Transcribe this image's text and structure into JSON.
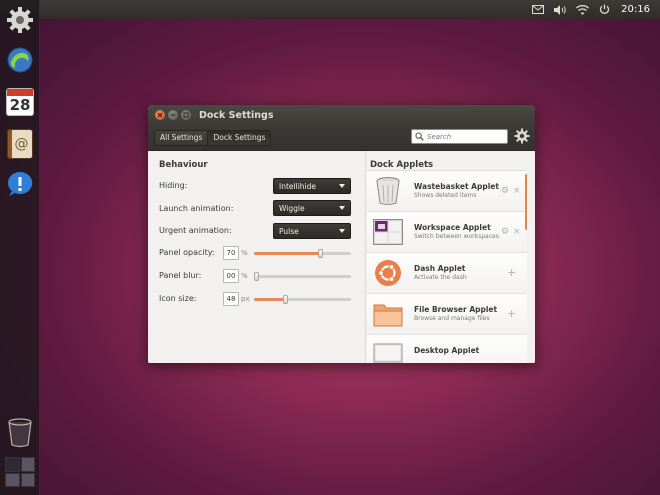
{
  "top_panel": {
    "icons": [
      "mail-icon",
      "volume-icon",
      "wifi-icon",
      "power-icon"
    ],
    "clock": "20:16"
  },
  "launcher": {
    "items": [
      {
        "name": "settings-launcher-icon"
      },
      {
        "name": "browser-launcher-icon"
      },
      {
        "name": "calendar-launcher-icon",
        "text": "28"
      },
      {
        "name": "contacts-launcher-icon",
        "text": "@"
      },
      {
        "name": "notify-launcher-icon",
        "text": "!"
      }
    ],
    "bottom": [
      "trash-icon",
      "workspace-switcher-icon"
    ]
  },
  "window": {
    "title": "Dock Settings",
    "breadcrumbs": [
      {
        "label": "All Settings",
        "active": false
      },
      {
        "label": "Dock Settings",
        "active": true
      }
    ],
    "search_placeholder": "Search",
    "behaviour": {
      "title": "Behaviour",
      "hiding_label": "Hiding:",
      "hiding_value": "Intellihide",
      "launch_label": "Launch animation:",
      "launch_value": "Wiggle",
      "urgent_label": "Urgent animation:",
      "urgent_value": "Pulse",
      "opacity_label": "Panel opacity:",
      "opacity_value": "70",
      "opacity_unit": "%",
      "opacity_slider": 0.7,
      "blur_label": "Panel blur:",
      "blur_value": "00",
      "blur_unit": "%",
      "blur_slider": 0.0,
      "icon_size_label": "Icon size:",
      "icon_size_value": "48",
      "icon_size_unit": "px",
      "icon_size_slider": 0.32
    },
    "applets": {
      "title": "Dock Applets",
      "items": [
        {
          "name": "Wastebasket Applet",
          "desc": "Shows deleted items",
          "icon": "wastebasket-icon",
          "installed": true
        },
        {
          "name": "Workspace Applet",
          "desc": "Switch between workspaces",
          "icon": "workspace-icon",
          "installed": true
        },
        {
          "name": "Dash Applet",
          "desc": "Activate the dash",
          "icon": "ubuntu-logo-icon",
          "installed": false
        },
        {
          "name": "File Browser Applet",
          "desc": "Browse and manage files",
          "icon": "folder-icon",
          "installed": false
        },
        {
          "name": "Desktop Applet",
          "desc": "",
          "icon": "desktop-icon",
          "installed": false
        }
      ]
    }
  }
}
